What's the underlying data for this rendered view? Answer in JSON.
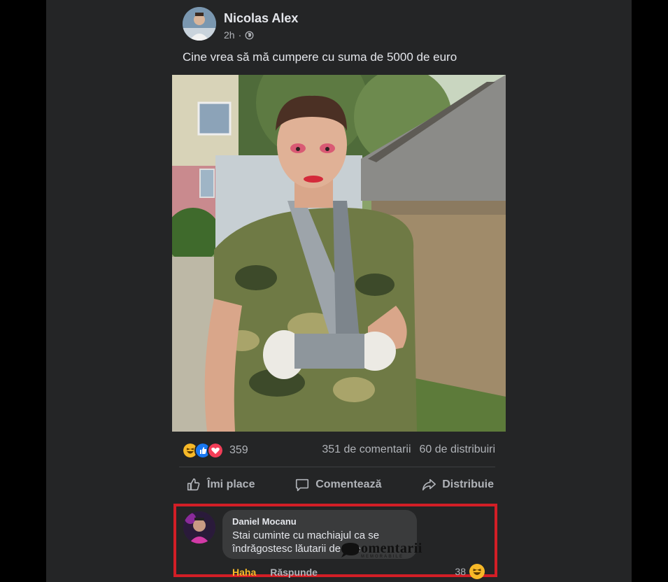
{
  "post": {
    "author": "Nicolas Alex",
    "time": "2h",
    "separator": "·",
    "privacy_icon": "globe-icon",
    "text": "Cine vrea să mă cumpere cu suma de 5000 de euro"
  },
  "stats": {
    "reaction_icons": [
      "haha-icon",
      "like-icon",
      "love-icon"
    ],
    "reaction_count": "359",
    "comments": "351 de comentarii",
    "shares": "60 de distribuiri"
  },
  "actions": {
    "like": "Îmi place",
    "comment": "Comentează",
    "share": "Distribuie"
  },
  "comment": {
    "author": "Daniel Mocanu",
    "text": "Stai cuminte cu machiajul ca se îndrăgostesc lăutarii de tine",
    "haha": "Haha",
    "reply": "Răspunde",
    "reaction_count": "38",
    "reaction_icon": "haha-icon"
  },
  "watermark": {
    "main": "omentarii",
    "sub": "MEMORABILE"
  },
  "colors": {
    "background": "#242526",
    "highlight_border": "#d21e26",
    "haha": "#f7b928",
    "like": "#1877f2",
    "love": "#f33e58"
  }
}
